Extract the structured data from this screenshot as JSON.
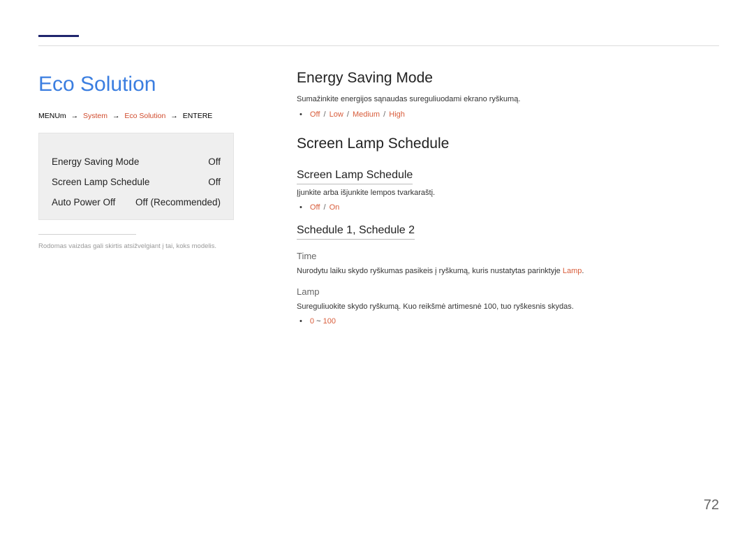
{
  "section_title": "Eco Solution",
  "breadcrumb": {
    "p1": "MENU",
    "p1b": "m",
    "p2": "System",
    "p3": "Eco Solution",
    "p4": "ENTER",
    "p4b": "E"
  },
  "panel": {
    "rows": [
      {
        "label": "Energy Saving Mode",
        "value": "Off"
      },
      {
        "label": "Screen Lamp Schedule",
        "value": "Off"
      },
      {
        "label": "Auto Power Off",
        "value": "Off (Recommended)"
      }
    ]
  },
  "tiny_note": "Rodomas vaizdas gali skirtis atsižvelgiant į tai, koks modelis.",
  "energy_saving": {
    "title": "Energy Saving Mode",
    "desc": "Sumažinkite energijos sąnaudas sureguliuodami ekrano ryškumą.",
    "opts": {
      "off": "Off",
      "low": "Low",
      "medium": "Medium",
      "high": "High"
    }
  },
  "lamp_schedule": {
    "title": "Screen Lamp Schedule",
    "sub": {
      "title": "Screen Lamp Schedule",
      "desc": "Įjunkite arba išjunkite lempos tvarkaraštį.",
      "opts": {
        "off": "Off",
        "on": "On"
      }
    },
    "sched12": {
      "title": "Schedule 1, Schedule 2",
      "time_label": "Time",
      "time_desc_a": "Nurodytu laiku skydo ryškumas pasikeis į ryškumą, kuris nustatytas parinktyje ",
      "time_desc_b": "Lamp",
      "time_desc_c": ".",
      "lamp_label": "Lamp",
      "lamp_desc": "Sureguliuokite skydo ryškumą. Kuo reikšmė artimesnė 100, tuo ryškesnis skydas.",
      "lamp_range_a": "0",
      "lamp_range_sep": " ~ ",
      "lamp_range_b": "100"
    }
  },
  "page_number": "72"
}
